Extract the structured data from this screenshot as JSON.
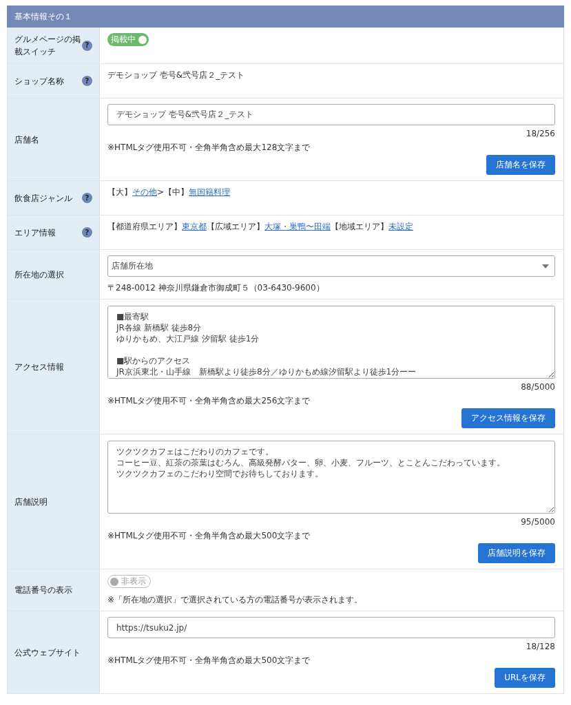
{
  "panel": {
    "title": "基本情報その１"
  },
  "rows": [
    {
      "label": "グルメページの掲載スイッチ",
      "help": "?",
      "kind": "toggle",
      "toggle": {
        "label": "掲載中",
        "on": true
      }
    },
    {
      "label": "ショップ名称",
      "help": "?",
      "kind": "text",
      "text": "デモショップ 壱号&弐号店２_テスト"
    },
    {
      "label": "店舗名",
      "kind": "input",
      "value": "デモショップ 壱号&弐号店２_テスト",
      "counter": "18/256",
      "note": "※HTMLタグ使用不可・全角半角含め最大128文字まで",
      "button": "店舗名を保存"
    },
    {
      "label": "飲食店ジャンル",
      "help": "?",
      "kind": "links",
      "segments": [
        {
          "text": "【大】",
          "kind": "plain"
        },
        {
          "text": "その他",
          "kind": "link"
        },
        {
          "text": ">【中】",
          "kind": "plain"
        },
        {
          "text": "無国籍料理",
          "kind": "link"
        }
      ]
    },
    {
      "label": "エリア情報",
      "help": "?",
      "kind": "links",
      "segments": [
        {
          "text": "【都道府県エリア】",
          "kind": "plain"
        },
        {
          "text": "東京都",
          "kind": "link"
        },
        {
          "text": "【広域エリア】",
          "kind": "plain"
        },
        {
          "text": "大塚・巣鴨〜田端",
          "kind": "link"
        },
        {
          "text": "【地域エリア】",
          "kind": "plain"
        },
        {
          "text": "未設定",
          "kind": "link"
        }
      ]
    },
    {
      "label": "所在地の選択",
      "kind": "select",
      "value": "店舗所在地",
      "note": "〒248-0012 神奈川県鎌倉市御成町５（03-6430-9600）"
    },
    {
      "label": "アクセス情報",
      "kind": "textarea",
      "paragraphs": [
        [
          "■最寄駅",
          "JR各線 新橋駅 徒歩8分",
          "ゆりかもめ、大江戸線 汐留駅 徒歩1分"
        ],
        [
          "■駅からのアクセス",
          "JR京浜東北・山手線　新橋駅より徒歩8分／ゆりかもめ線汐留駅より徒歩1分ーー"
        ]
      ],
      "counter": "88/5000",
      "note": "※HTMLタグ使用不可・全角半角含め最大256文字まで",
      "button": "アクセス情報を保存"
    },
    {
      "label": "店舗説明",
      "kind": "textarea",
      "paragraphs": [
        [
          "ツクツクカフェはこだわりのカフェです。",
          "コーヒー豆、紅茶の茶葉はむろん、高級発酵バター、卵、小麦、フルーツ、とことんこだわっています。",
          "ツクツクカフェのこだわり空間でお待ちしております。"
        ]
      ],
      "counter": "95/5000",
      "note": "※HTMLタグ使用不可・全角半角含め最大500文字まで",
      "button": "店舗説明を保存"
    },
    {
      "label": "電話番号の表示",
      "kind": "toggle",
      "toggle": {
        "label": "非表示",
        "on": false
      },
      "note": "※「所在地の選択」で選択されている方の電話番号が表示されます。"
    },
    {
      "label": "公式ウェブサイト",
      "kind": "input",
      "value": "https://tsuku2.jp/",
      "counter": "18/128",
      "note": "※HTMLタグ使用不可・全角半角含め最大500文字まで",
      "button": "URLを保存"
    }
  ]
}
